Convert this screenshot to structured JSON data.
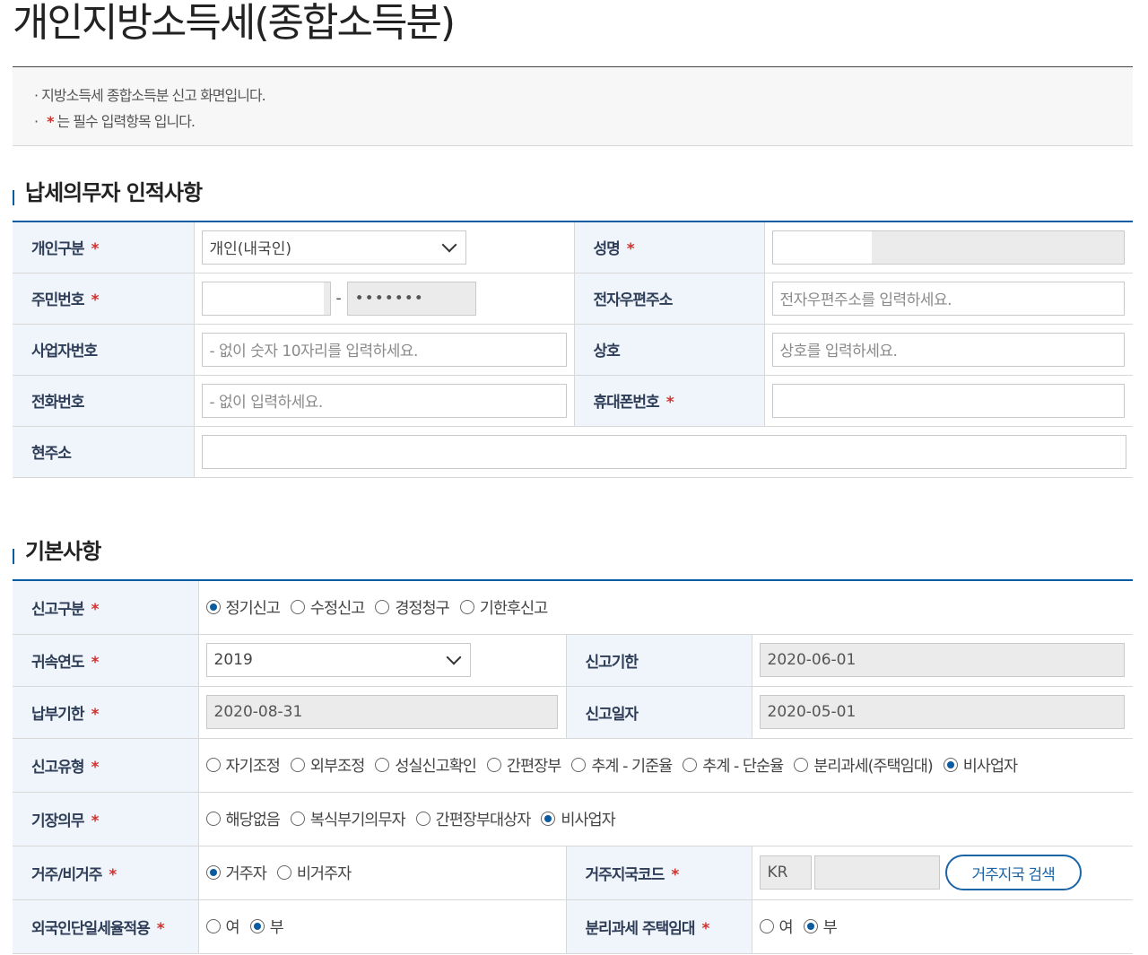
{
  "page": {
    "title": "개인지방소득세(종합소득분)",
    "notice": [
      "지방소득세 종합소득분 신고 화면입니다.",
      "는 필수 입력항목 입니다."
    ],
    "required_mark": "*"
  },
  "taxpayer": {
    "section_title": "납세의무자 인적사항",
    "person_type_label": "개인구분",
    "person_type_value": "개인(내국인)",
    "name_label": "성명",
    "name_value": "",
    "rrn_label": "주민번호",
    "rrn_front": "",
    "rrn_sep": "-",
    "rrn_back": "•••••••",
    "epost_label": "전자우편주소",
    "epost_placeholder": "전자우편주소를 입력하세요.",
    "bizno_label": "사업자번호",
    "bizno_placeholder": "- 없이 숫자 10자리를 입력하세요.",
    "company_label": "상호",
    "company_placeholder": "상호를 입력하세요.",
    "phone_label": "전화번호",
    "phone_placeholder": "- 없이 입력하세요.",
    "mobile_label": "휴대폰번호",
    "mobile_value": "",
    "address_label": "현주소",
    "address_value": ""
  },
  "basic": {
    "section_title": "기본사항",
    "report_type_label": "신고구분",
    "report_type_options": [
      "정기신고",
      "수정신고",
      "경정청구",
      "기한후신고"
    ],
    "report_type_selected": 0,
    "year_label": "귀속연도",
    "year_value": "2019",
    "deadline_label": "신고기한",
    "deadline_value": "2020-06-01",
    "pay_deadline_label": "납부기한",
    "pay_deadline_value": "2020-08-31",
    "report_date_label": "신고일자",
    "report_date_value": "2020-05-01",
    "report_kind_label": "신고유형",
    "report_kind_options": [
      "자기조정",
      "외부조정",
      "성실신고확인",
      "간편장부",
      "추계 - 기준율",
      "추계 - 단순율",
      "분리과세(주택임대)",
      "비사업자"
    ],
    "report_kind_selected": 7,
    "bookkeeping_label": "기장의무",
    "bookkeeping_options": [
      "해당없음",
      "복식부기의무자",
      "간편장부대상자",
      "비사업자"
    ],
    "bookkeeping_selected": 3,
    "residency_label": "거주/비거주",
    "residency_options": [
      "거주자",
      "비거주자"
    ],
    "residency_selected": 0,
    "country_label": "거주지국코드",
    "country_code": "KR",
    "country_name": "",
    "country_search_button": "거주지국 검색",
    "foreign_flat_label": "외국인단일세율적용",
    "foreign_flat_options": [
      "여",
      "부"
    ],
    "foreign_flat_selected": 1,
    "separate_rental_label": "분리과세 주택임대",
    "separate_rental_options": [
      "여",
      "부"
    ],
    "separate_rental_selected": 1
  }
}
